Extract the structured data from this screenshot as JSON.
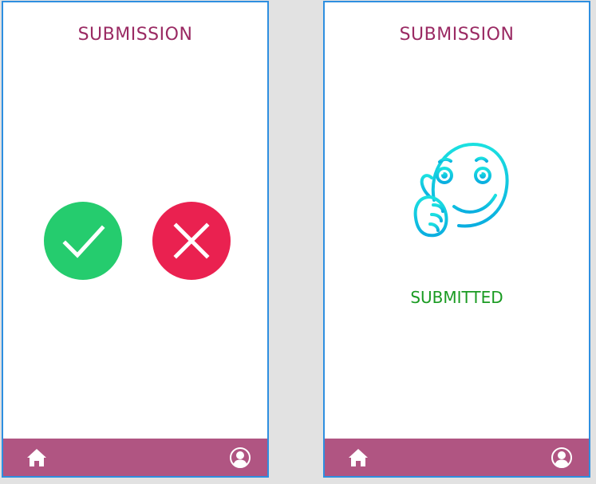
{
  "screens": [
    {
      "title": "SUBMISSION",
      "actions": {
        "accept_icon": "checkmark-icon",
        "reject_icon": "cross-icon",
        "accept_color": "#25cc6e",
        "reject_color": "#ea2150"
      },
      "nav": {
        "home_icon": "home-icon",
        "profile_icon": "user-profile-icon"
      }
    },
    {
      "title": "SUBMISSION",
      "illustration": "thumbs-up-smiley-icon",
      "status": "SUBMITTED",
      "status_color": "#1a9b22",
      "nav": {
        "home_icon": "home-icon",
        "profile_icon": "user-profile-icon"
      }
    }
  ],
  "colors": {
    "title": "#9a2a63",
    "nav_bar": "#b05582",
    "frame_border": "#2e8fe0",
    "illustration": "#14c8e0"
  }
}
